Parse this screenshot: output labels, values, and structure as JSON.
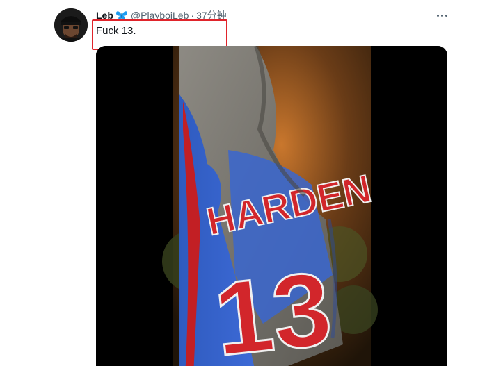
{
  "tweet": {
    "author": {
      "display_name": "Leb",
      "badge_icon": "butterfly-icon",
      "handle": "@PlayboiLeb",
      "separator": "·",
      "time": "37分钟"
    },
    "text": "Fuck 13.",
    "media": {
      "type": "video",
      "jersey_name": "HARDEN",
      "jersey_number": "13"
    }
  },
  "colors": {
    "highlight_box": "#e0242b",
    "secondary_text": "#536471",
    "badge": "#1d9bf0",
    "jersey_blue": "#2a5cc9",
    "jersey_red": "#d2262b"
  }
}
